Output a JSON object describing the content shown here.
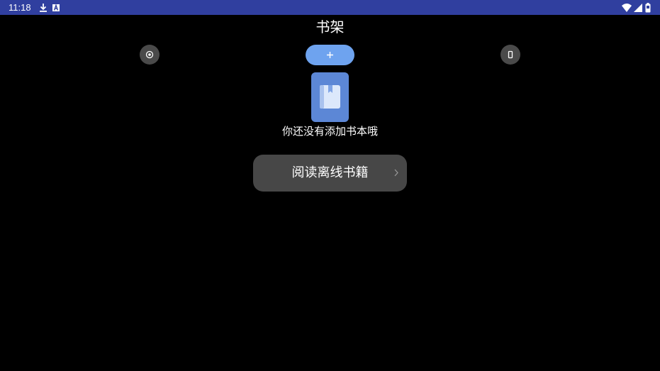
{
  "status_bar": {
    "time": "11:18",
    "icons_left": [
      "download-icon",
      "a-icon"
    ],
    "icons_right": [
      "wifi-icon",
      "signal-icon",
      "battery-icon"
    ],
    "color": "#303f9f"
  },
  "header": {
    "title": "书架",
    "left_button_icon": "target-icon",
    "add_button_label": "+",
    "right_button_icon": "phone-icon",
    "accent": "#6ea3ef"
  },
  "empty_state": {
    "icon": "book-icon",
    "message": "你还没有添加书本哦"
  },
  "offline_button": {
    "label": "阅读离线书籍",
    "icon": "chevron-right-icon"
  }
}
